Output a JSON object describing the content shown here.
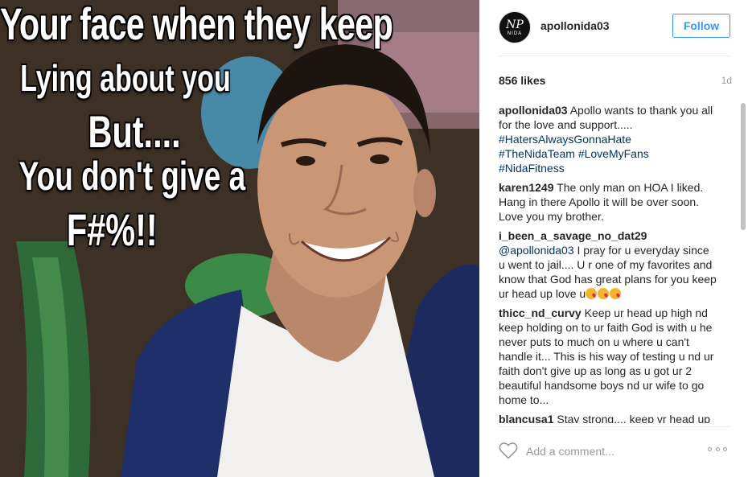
{
  "post": {
    "meme_lines": [
      "Your face when they keep",
      "Lying about you",
      "But....",
      "You don't give a",
      "F#%!!"
    ]
  },
  "header": {
    "avatar_text_top": "NP",
    "avatar_text_bottom": "NIDA",
    "username": "apollonida03",
    "follow_label": "Follow"
  },
  "stats": {
    "likes": "856 likes",
    "age": "1d"
  },
  "comments": [
    {
      "user": "apollonida03",
      "text": "Apollo wants to thank you all for the love and support.....",
      "hashtags": [
        "#HatersAlwaysGonnaHate",
        "#TheNidaTeam",
        "#LoveMyFans",
        "#NidaFitness"
      ]
    },
    {
      "user": "karen1249",
      "text": "The only man on HOA I liked. Hang in there Apollo it will be over soon. Love you my brother."
    },
    {
      "user": "i_been_a_savage_no_dat29",
      "mention": "@apollonida03",
      "text": "I pray for u everyday since u went to jail.... U r one of my favorites and know that God has great plans for you keep ur head up love u"
    },
    {
      "user": "thicc_nd_curvy",
      "text": "Keep ur head up high nd keep holding on to ur faith God is with u he never puts to much on u where u can't handle it... This is his way of testing u nd ur faith don't give up as long as u got ur 2 beautiful handsome boys nd ur wife to go home to..."
    },
    {
      "user": "blancusa1",
      "text": "Stay strong.... keep yr head up"
    }
  ],
  "footer": {
    "comment_placeholder": "Add a comment..."
  },
  "icons": {
    "like": "heart-icon",
    "more": "more-options-icon"
  },
  "colors": {
    "accent": "#3897f0",
    "hashtag": "#003569",
    "muted": "#999999"
  }
}
